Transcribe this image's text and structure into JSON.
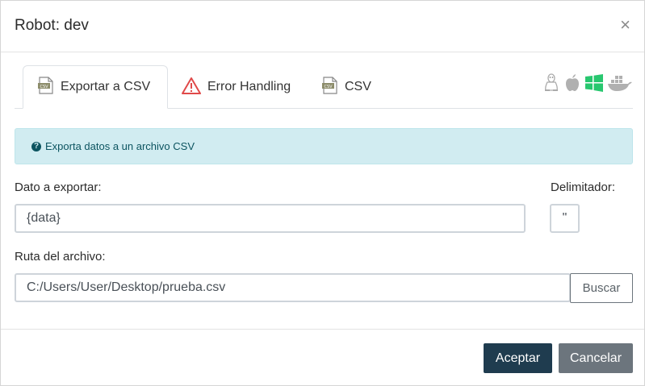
{
  "dialog": {
    "title": "Robot: dev",
    "close_glyph": "×"
  },
  "tabs": [
    {
      "label": "Exportar a CSV",
      "icon": "csv-file-icon",
      "active": true
    },
    {
      "label": "Error Handling",
      "icon": "warning-icon",
      "active": false
    },
    {
      "label": "CSV",
      "icon": "csv-file-icon",
      "active": false
    }
  ],
  "os_icons": [
    "linux-icon",
    "apple-icon",
    "windows-icon",
    "docker-icon"
  ],
  "colors": {
    "windows": "#28c76f",
    "os_gray": "#b0b0b0",
    "primary": "#1f3c4f",
    "secondary": "#6c757d",
    "info_bg": "#d1ecf1",
    "warning_red": "#e04a4a"
  },
  "info": {
    "icon": "question-circle-icon",
    "text": "Exporta datos a un archivo CSV"
  },
  "form": {
    "data_label": "Dato a exportar:",
    "data_value": "{data}",
    "delimiter_label": "Delimitador:",
    "delimiter_value": "\"",
    "path_label": "Ruta del archivo:",
    "path_value": "C:/Users/User/Desktop/prueba.csv",
    "browse_label": "Buscar"
  },
  "footer": {
    "accept_label": "Aceptar",
    "cancel_label": "Cancelar"
  }
}
